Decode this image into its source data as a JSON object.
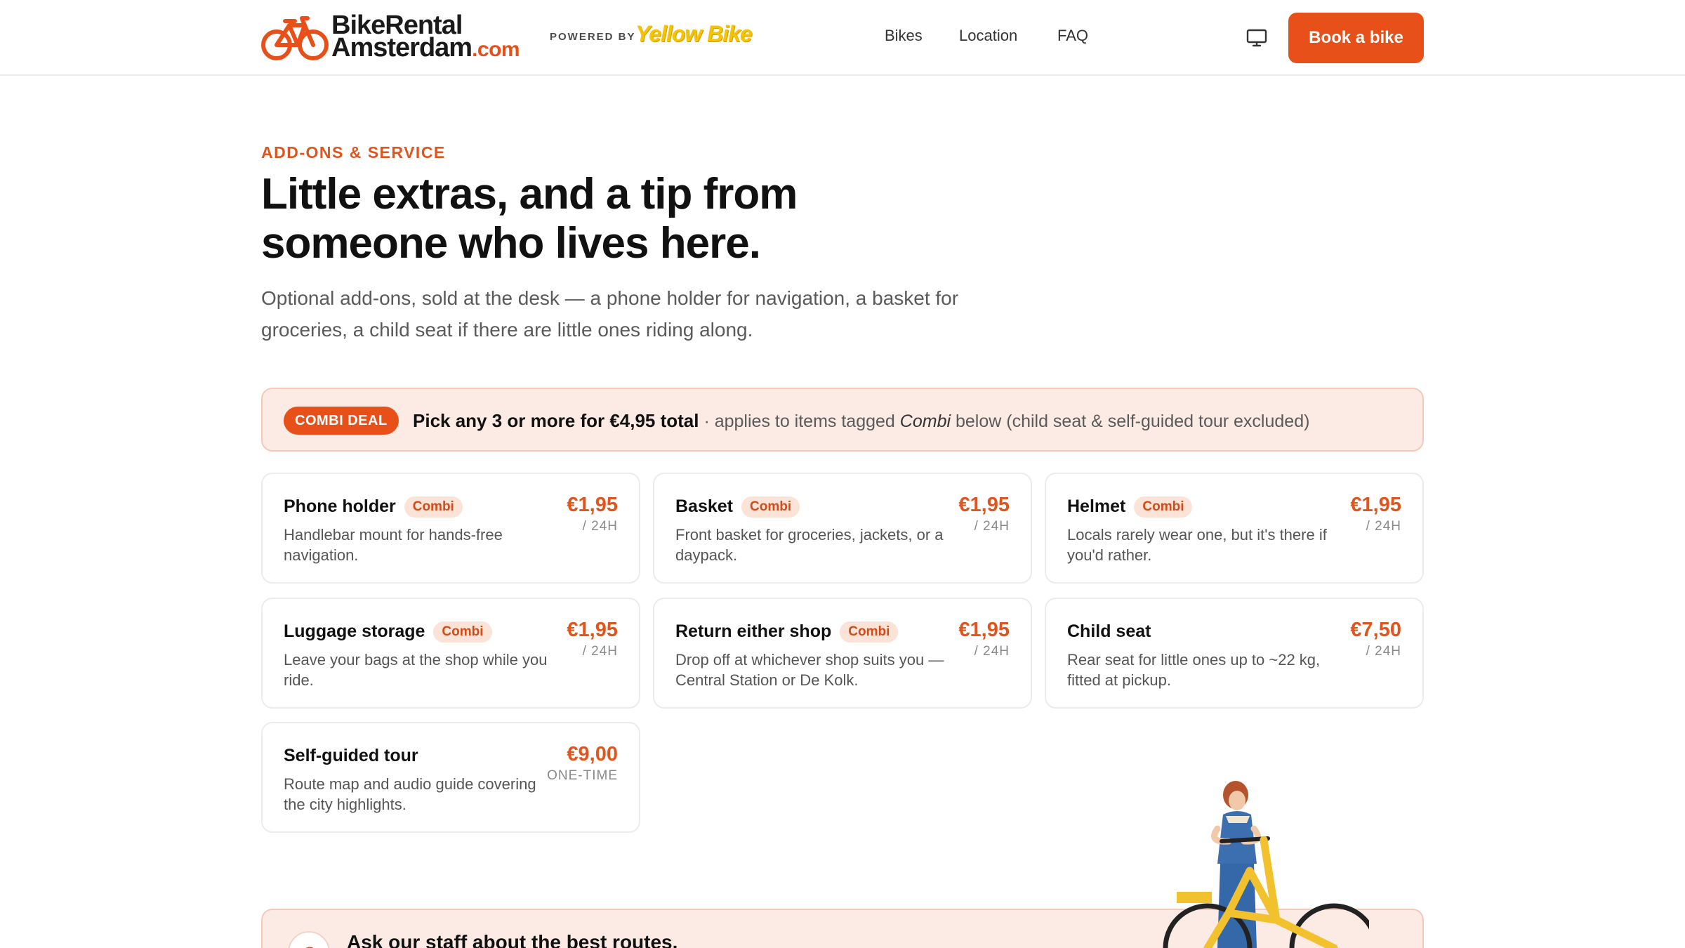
{
  "header": {
    "logo_line1": "BikeRental",
    "logo_line2": "Amsterdam",
    "logo_tld": ".com",
    "powered_by": "POWERED BY",
    "partner": "Yellow Bike",
    "nav": [
      "Bikes",
      "Location",
      "FAQ"
    ],
    "monitor_icon": "monitor-icon",
    "cta": "Book a bike"
  },
  "hero": {
    "eyebrow": "ADD-ONS & SERVICE",
    "headline": "Little extras, and a tip from someone who lives here.",
    "intro": "Optional add-ons, sold at the desk — a phone holder for navigation, a basket for groceries, a child seat if there are little ones riding along."
  },
  "combi": {
    "badge": "COMBI DEAL",
    "bold": "Pick any 3 or more for €4,95 total",
    "pre": " · applies to items tagged ",
    "italic": "Combi",
    "post": " below (child seat & self-guided tour excluded)"
  },
  "cards": [
    {
      "title": "Phone holder",
      "tag": "Combi",
      "desc": "Handlebar mount for hands-free navigation.",
      "price": "€1,95",
      "unit": "/ 24H"
    },
    {
      "title": "Basket",
      "tag": "Combi",
      "desc": "Front basket for groceries, jackets, or a daypack.",
      "price": "€1,95",
      "unit": "/ 24H"
    },
    {
      "title": "Helmet",
      "tag": "Combi",
      "desc": "Locals rarely wear one, but it's there if you'd rather.",
      "price": "€1,95",
      "unit": "/ 24H"
    },
    {
      "title": "Luggage storage",
      "tag": "Combi",
      "desc": "Leave your bags at the shop while you ride.",
      "price": "€1,95",
      "unit": "/ 24H"
    },
    {
      "title": "Return either shop",
      "tag": "Combi",
      "desc": "Drop off at whichever shop suits you — Central Station or De Kolk.",
      "price": "€1,95",
      "unit": "/ 24H"
    },
    {
      "title": "Child seat",
      "tag": "",
      "desc": "Rear seat for little ones up to ~22 kg, fitted at pickup.",
      "price": "€7,50",
      "unit": "/ 24H"
    },
    {
      "title": "Self-guided tour",
      "tag": "",
      "desc": "Route map and audio guide covering the city highlights.",
      "price": "€9,00",
      "unit": "ONE-TIME"
    }
  ],
  "bottom": {
    "text": "Ask our staff about the best routes."
  },
  "colors": {
    "accent": "#e8501a",
    "banner_bg": "#fcebe4",
    "tag_bg": "#fbe3d8"
  }
}
